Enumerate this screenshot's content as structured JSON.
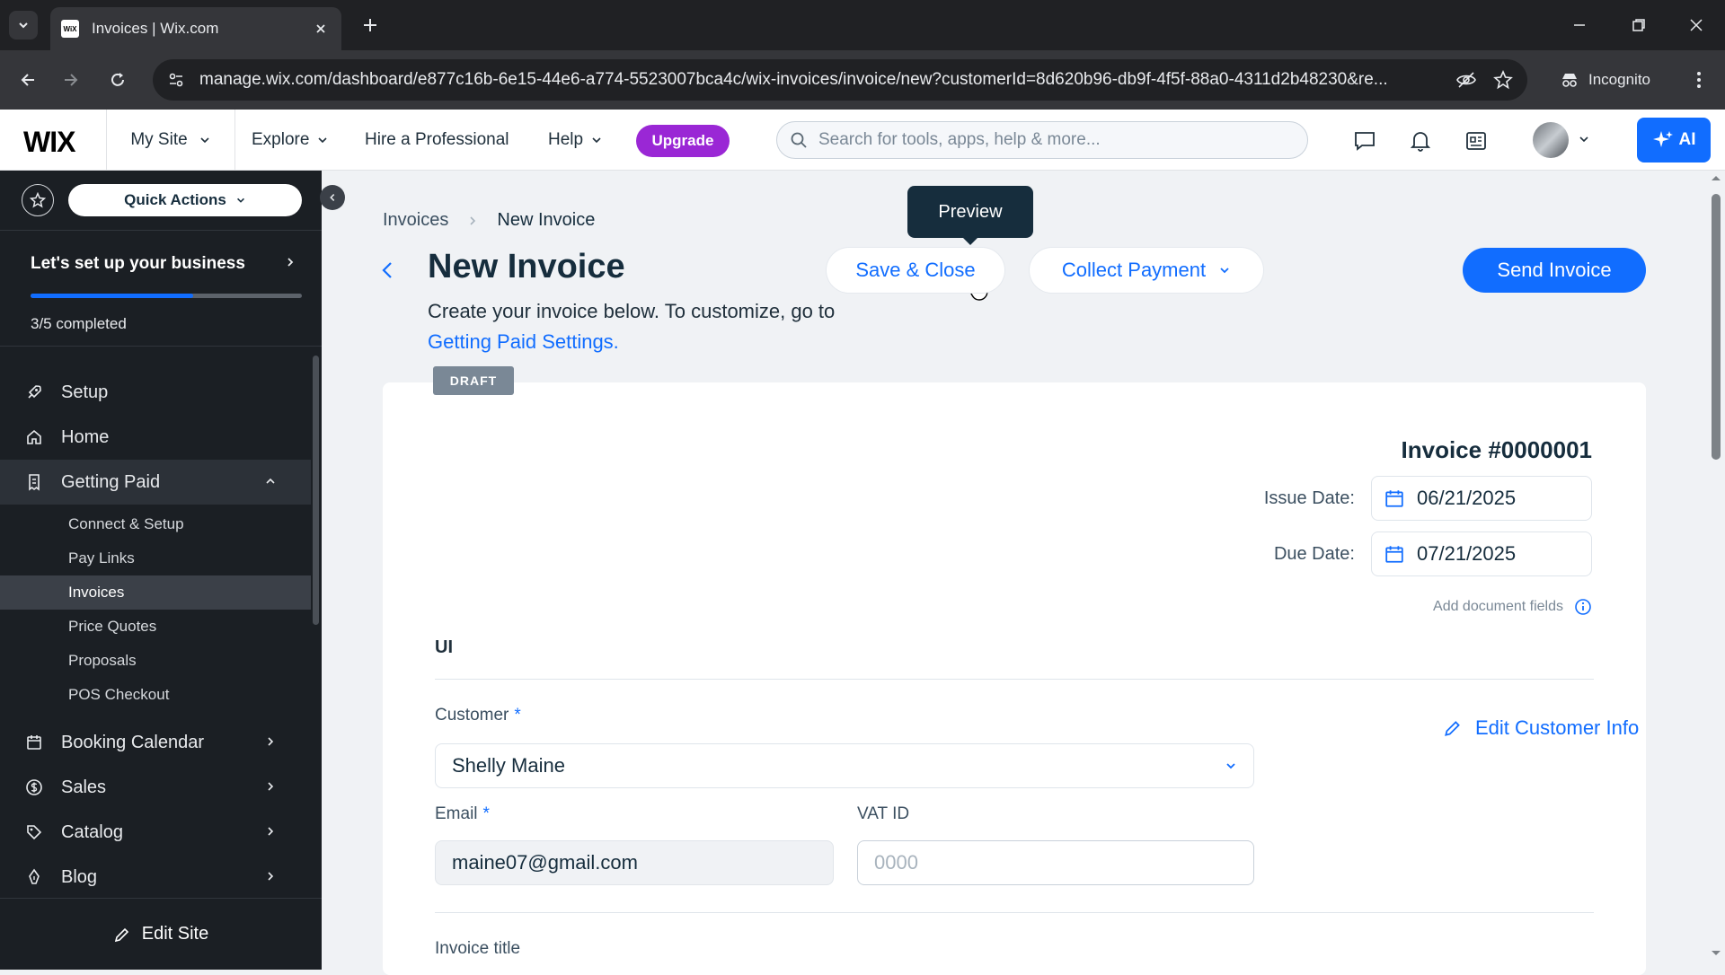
{
  "browser": {
    "tab_title": "Invoices | Wix.com",
    "favicon_text": "WiX",
    "url": "manage.wix.com/dashboard/e877c16b-6e15-44e6-a774-5523007bca4c/wix-invoices/invoice/new?customerId=8d620b96-db9f-4f5f-88a0-4311d2b48230&re...",
    "incognito_label": "Incognito"
  },
  "topbar": {
    "logo": "WIX",
    "my_site": "My Site",
    "explore": "Explore",
    "hire": "Hire a Professional",
    "help": "Help",
    "upgrade": "Upgrade",
    "search_placeholder": "Search for tools, apps, help & more...",
    "ai_label": "AI"
  },
  "sidebar": {
    "quick_actions": "Quick Actions",
    "setup_title": "Let's set up your business",
    "setup_progress": 0.6,
    "setup_count": "3/5 completed",
    "items": {
      "setup": "Setup",
      "home": "Home",
      "getting_paid": "Getting Paid",
      "booking": "Booking Calendar",
      "sales": "Sales",
      "catalog": "Catalog",
      "blog": "Blog"
    },
    "sub_items": [
      "Connect & Setup",
      "Pay Links",
      "Invoices",
      "Price Quotes",
      "Proposals",
      "POS Checkout"
    ],
    "active_sub": "Invoices",
    "edit_site": "Edit Site"
  },
  "main": {
    "breadcrumb": {
      "parent": "Invoices",
      "current": "New Invoice"
    },
    "title": "New Invoice",
    "description": "Create your invoice below. To customize, go to",
    "settings_link": "Getting Paid Settings.",
    "tooltip": "Preview",
    "save_close": "Save & Close",
    "collect_payment": "Collect Payment",
    "send_invoice": "Send Invoice",
    "status": "DRAFT"
  },
  "invoice": {
    "number": "Invoice #0000001",
    "issue_label": "Issue Date:",
    "issue_date": "06/21/2025",
    "due_label": "Due Date:",
    "due_date": "07/21/2025",
    "add_fields": "Add document fields",
    "business_name": "UI",
    "customer_label": "Customer",
    "customer_value": "Shelly Maine",
    "edit_customer": "Edit Customer Info",
    "email_label": "Email",
    "email_value": "maine07@gmail.com",
    "vat_label": "VAT ID",
    "vat_placeholder": "0000",
    "title_label": "Invoice title",
    "required_mark": "*"
  },
  "colors": {
    "accent": "#116dff",
    "upgrade": "#9a27d5",
    "sidebar_bg": "#1b1f24",
    "text_dark": "#162d3d"
  }
}
